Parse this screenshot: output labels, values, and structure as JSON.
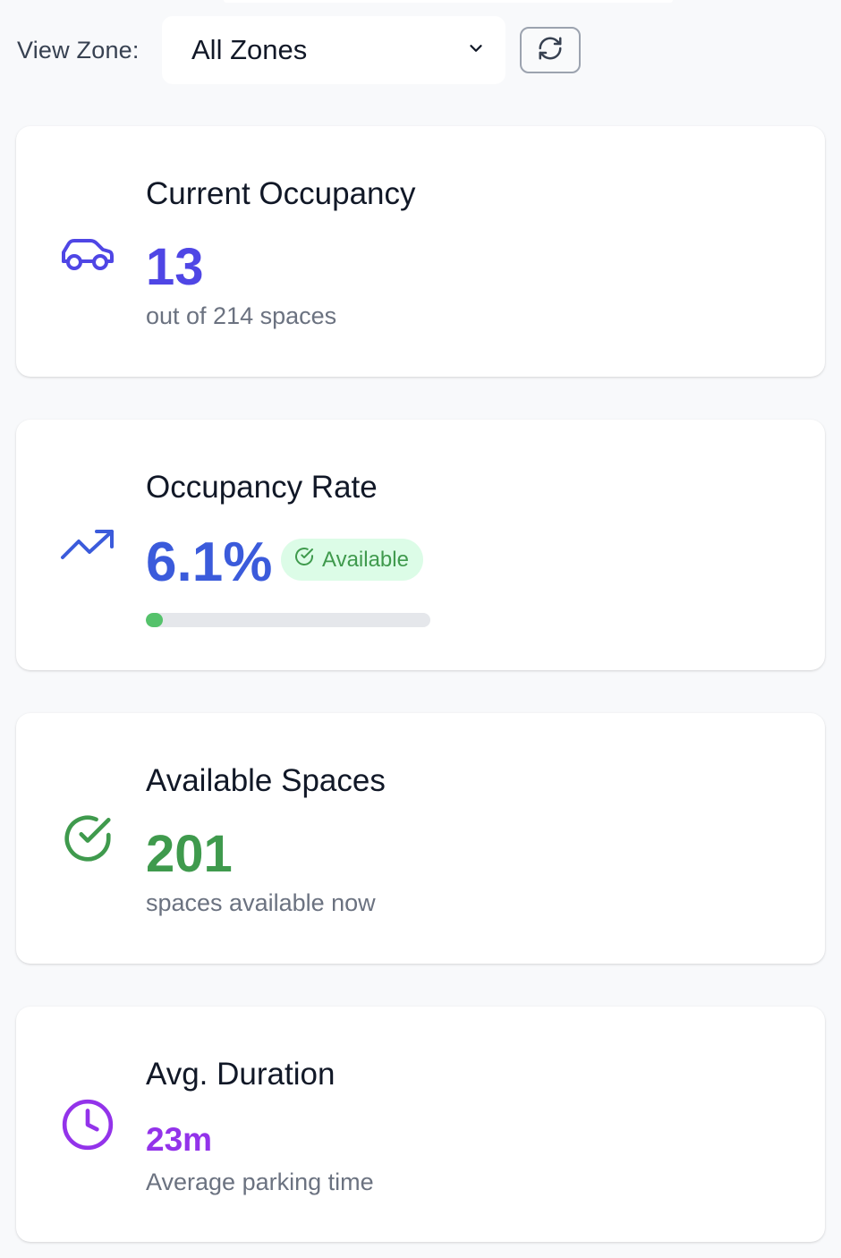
{
  "filter": {
    "label": "View Zone:",
    "selected_zone": "All Zones",
    "refresh_icon": "refresh-icon",
    "chevron_icon": "chevron-down-icon"
  },
  "cards": {
    "occupancy": {
      "title": "Current Occupancy",
      "value": "13",
      "subtitle": "out of 214 spaces",
      "icon": "car-icon",
      "color": "#4f46e5"
    },
    "rate": {
      "title": "Occupancy Rate",
      "value": "6.1%",
      "badge": "Available",
      "badge_icon": "check-circle-icon",
      "progress": 0.061,
      "icon": "trending-up-icon",
      "color": "#3b5bdb",
      "badge_color": "#3f9a4d",
      "progress_color": "#55c26b"
    },
    "available": {
      "title": "Available Spaces",
      "value": "201",
      "subtitle": "spaces available now",
      "icon": "check-circle-icon",
      "color": "#3f9a4d"
    },
    "duration": {
      "title": "Avg. Duration",
      "value": "23m",
      "subtitle": "Average parking time",
      "icon": "clock-icon",
      "color": "#9333ea"
    }
  }
}
